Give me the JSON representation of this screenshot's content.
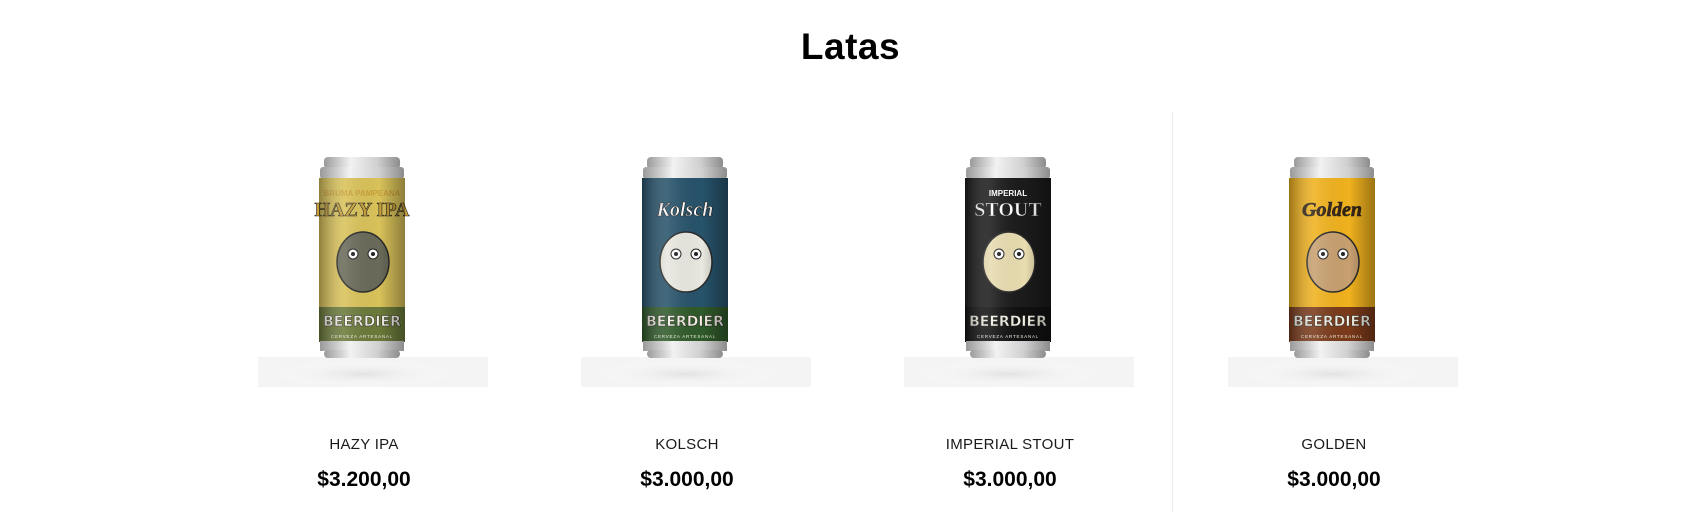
{
  "section": {
    "title": "Latas"
  },
  "products": [
    {
      "name": "HAZY IPA",
      "price": "$3.200,00",
      "label_top": "BRUMA PAMPEANA",
      "label_main": "HAZY IPA",
      "brand": "BEERDIER",
      "tagline": "CERVEZA ARTESANAL",
      "label_color": "#d9c25a",
      "label_bottom_color": "#6b7a3a",
      "title_color": "#c9a13a",
      "character_color": "#6a6a5a"
    },
    {
      "name": "KOLSCH",
      "price": "$3.000,00",
      "label_top": "",
      "label_main": "Kolsch",
      "brand": "BEERDIER",
      "tagline": "CERVEZA ARTESANAL",
      "label_color": "#27536b",
      "label_bottom_color": "#2f5a2a",
      "title_color": "#ffffff",
      "character_color": "#e8e8e0"
    },
    {
      "name": "IMPERIAL STOUT",
      "price": "$3.000,00",
      "label_top": "IMPERIAL",
      "label_main": "STOUT",
      "brand": "BEERDIER",
      "tagline": "CERVEZA ARTESANAL",
      "label_color": "#1b1b1b",
      "label_bottom_color": "#111111",
      "title_color": "#ffffff",
      "character_color": "#e8dcb0"
    },
    {
      "name": "GOLDEN",
      "price": "$3.000,00",
      "label_top": "",
      "label_main": "Golden",
      "brand": "BEERDIER",
      "tagline": "CERVEZA ARTESANAL",
      "label_color": "#f0b21e",
      "label_bottom_color": "#7a3a1a",
      "title_color": "#3a2410",
      "character_color": "#c8a070"
    }
  ]
}
